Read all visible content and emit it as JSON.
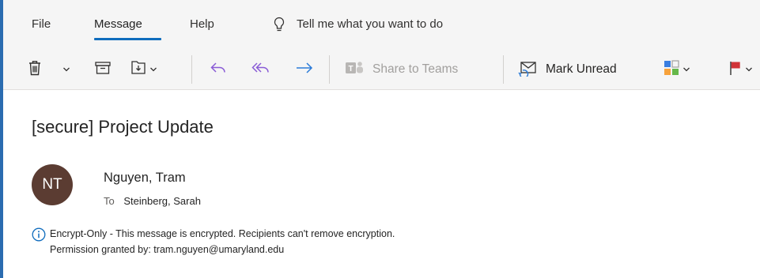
{
  "menu": {
    "tabs": [
      {
        "label": "File"
      },
      {
        "label": "Message"
      },
      {
        "label": "Help"
      }
    ],
    "tell_me": "Tell me what you want to do"
  },
  "toolbar": {
    "share_to_teams": "Share to Teams",
    "mark_unread": "Mark Unread"
  },
  "message": {
    "subject": "[secure] Project Update",
    "avatar_initials": "NT",
    "sender": "Nguyen, Tram",
    "to_label": "To",
    "recipient": "Steinberg, Sarah",
    "notice_line1": "Encrypt-Only - This message is encrypted. Recipients can't remove encryption.",
    "notice_line2": "Permission granted by: tram.nguyen@umaryland.edu"
  },
  "colors": {
    "accent": "#0f6cbd",
    "reply_purple": "#8a5cd6",
    "forward_blue": "#2b7bd8",
    "avatar_bg": "#5b3c32",
    "flag_red": "#d13438"
  },
  "icons": [
    "delete-icon",
    "archive-icon",
    "move-icon",
    "reply-icon",
    "reply-all-icon",
    "forward-icon",
    "teams-icon",
    "mark-unread-icon",
    "categorize-icon",
    "flag-icon",
    "lightbulb-icon",
    "info-icon"
  ]
}
